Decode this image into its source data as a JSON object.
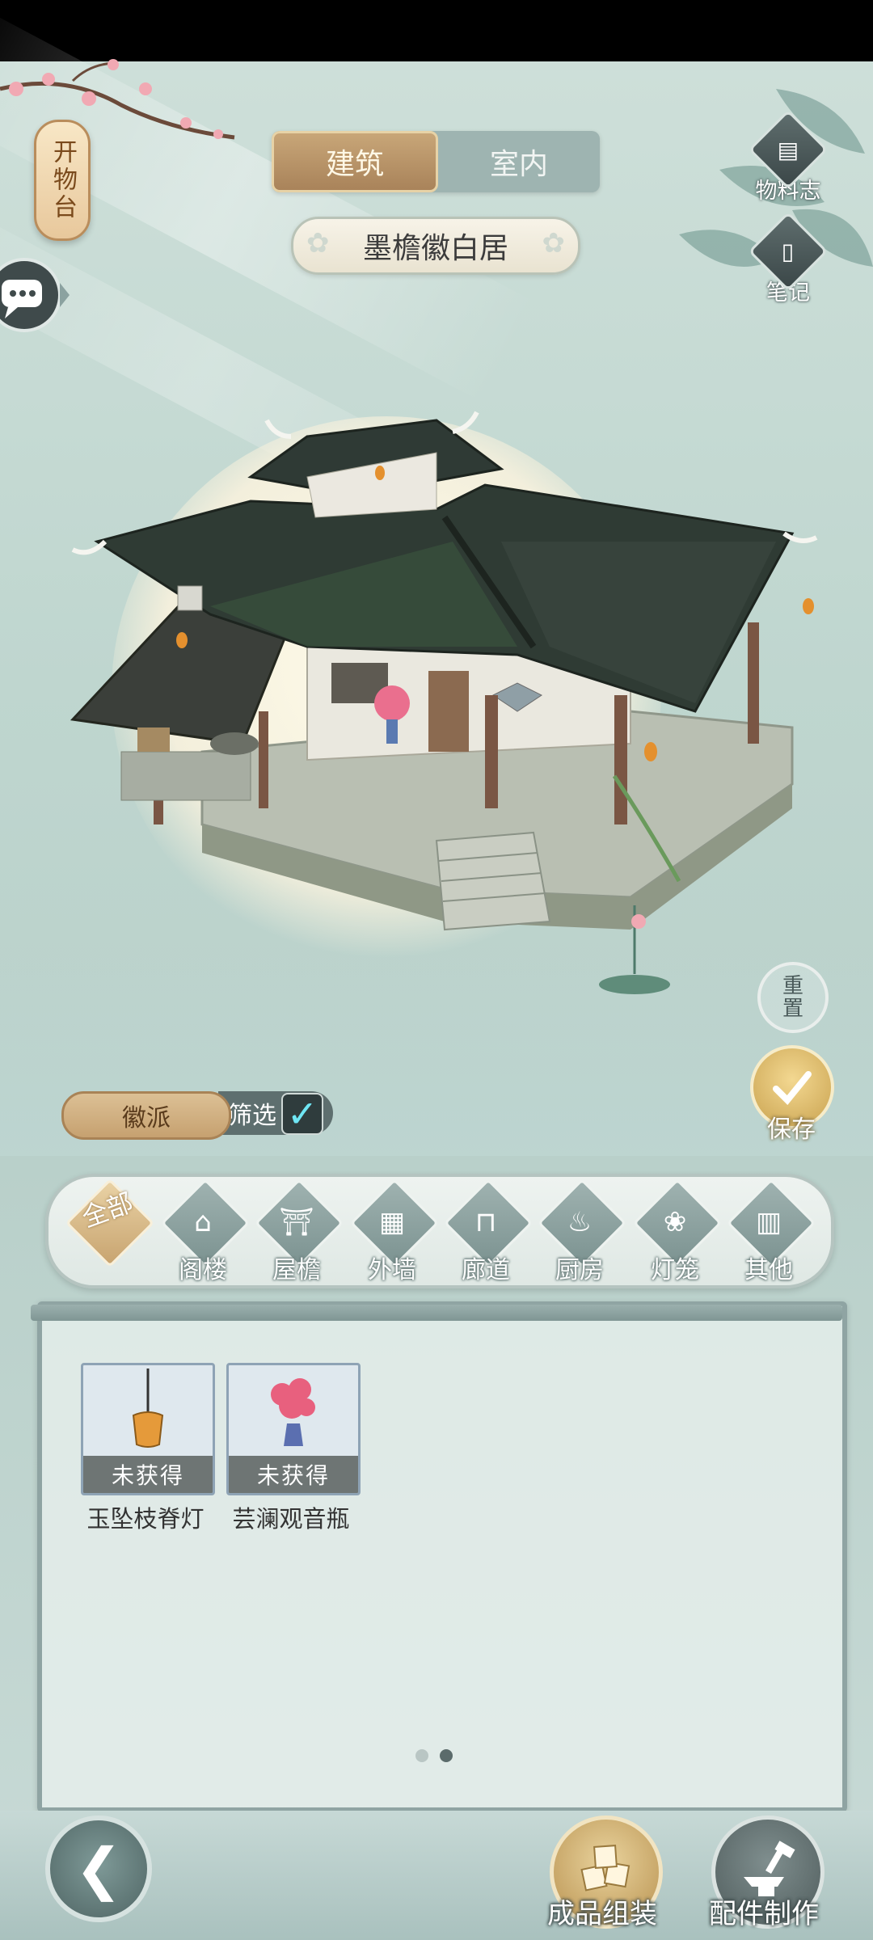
{
  "side_tag": "开物台",
  "tabs": [
    {
      "label": "建筑",
      "active": true
    },
    {
      "label": "室内",
      "active": false
    }
  ],
  "building_name": "墨檐徽白居",
  "right_menu": {
    "materials": "物料志",
    "notes": "笔记"
  },
  "reset_label": "重置",
  "save_label": "保存",
  "filter": {
    "style_tag": "徽派",
    "filter_label": "筛选",
    "filter_checked": true
  },
  "categories": [
    {
      "label": "全部",
      "icon": "all-icon",
      "active": true
    },
    {
      "label": "阁楼",
      "icon": "attic-icon"
    },
    {
      "label": "屋檐",
      "icon": "eaves-icon"
    },
    {
      "label": "外墙",
      "icon": "wall-icon"
    },
    {
      "label": "廊道",
      "icon": "corridor-icon"
    },
    {
      "label": "厨房",
      "icon": "kitchen-icon"
    },
    {
      "label": "灯笼",
      "icon": "lantern-icon"
    },
    {
      "label": "其他",
      "icon": "other-icon"
    }
  ],
  "items": [
    {
      "name": "玉坠枝脊灯",
      "status": "未获得",
      "icon": "ridge-lamp-icon"
    },
    {
      "name": "芸澜观音瓶",
      "status": "未获得",
      "icon": "flower-vase-icon"
    }
  ],
  "pagination": {
    "pages": 2,
    "current": 2
  },
  "bottom": {
    "assemble_label": "成品组装",
    "craft_label": "配件制作"
  },
  "colors": {
    "accent_gold": "#c8a678",
    "panel_border": "#8fa4a3",
    "check": "#6fe6f4"
  }
}
